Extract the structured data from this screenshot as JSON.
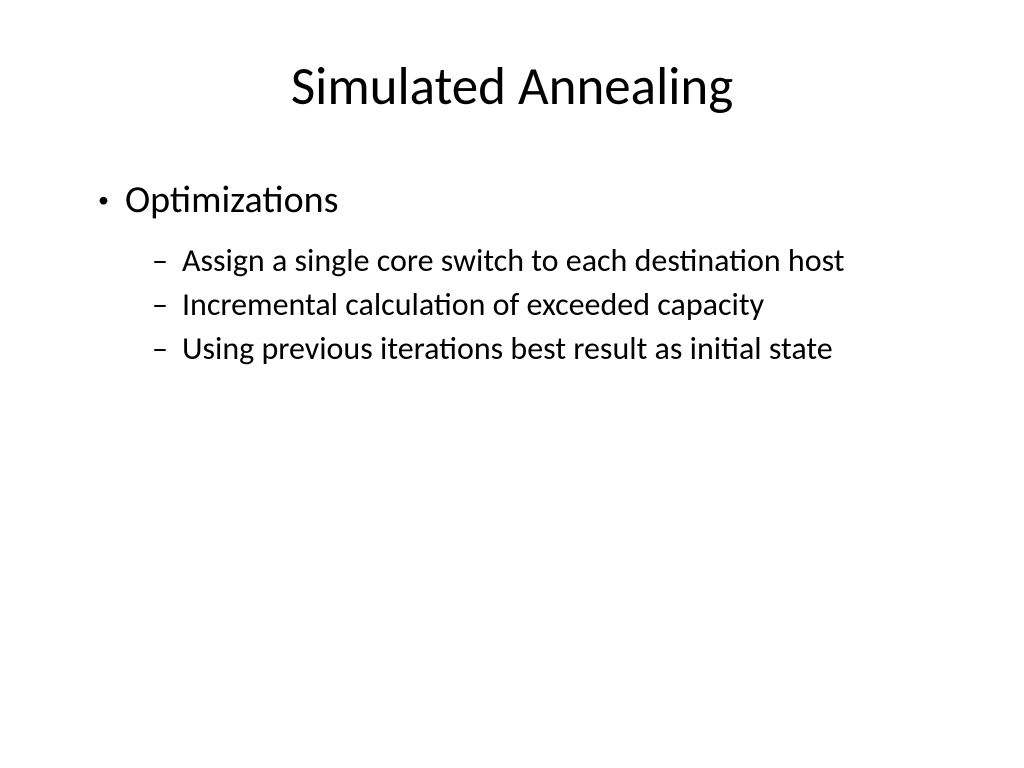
{
  "slide": {
    "title": "Simulated Annealing",
    "bullets": [
      {
        "text": "Optimizations",
        "children": [
          {
            "text": "Assign a single core switch to each destination host"
          },
          {
            "text": "Incremental calculation of exceeded capacity"
          },
          {
            "text": "Using previous iterations best result as initial state"
          }
        ]
      }
    ]
  },
  "markers": {
    "level1": "•",
    "level2": "–"
  }
}
